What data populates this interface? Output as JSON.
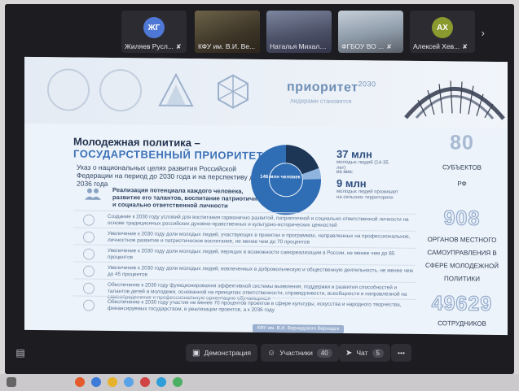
{
  "participants": [
    {
      "name": "Жиляев Русл...",
      "initials": "ЖГ",
      "color": "#4f78d6",
      "video": false,
      "mic_muted": true,
      "active": false
    },
    {
      "name": "КФУ им. В.И. Ве...",
      "initials": "",
      "color": "#5a4f3d",
      "video": true,
      "mic_muted": false,
      "active": true
    },
    {
      "name": "Наталья Михаль...",
      "initials": "",
      "color": "#6b6e7e",
      "video": true,
      "mic_muted": true,
      "active": false
    },
    {
      "name": "ФГБОУ ВО ...",
      "initials": "",
      "color": "#8d9aa8",
      "video": true,
      "mic_muted": true,
      "active": false
    },
    {
      "name": "Алексей Хев...",
      "initials": "АХ",
      "color": "#8a9a2f",
      "video": false,
      "mic_muted": true,
      "active": false
    }
  ],
  "next_icon": "chevron-right-icon",
  "slide": {
    "brand": "приоритет",
    "brand_year": "2030",
    "brand_sub": "лидерами становятся",
    "title_line1": "Молодежная политика –",
    "title_line2": "ГОСУДАРСТВЕННЫЙ ПРИОРИТЕТ",
    "decree": "Указ о национальных целях развития Российской Федерации на период до 2030 года и на перспективу до 2036 года",
    "potential": "Реализация потенциала каждого человека, развитие его талантов, воспитание патриотичной и социально ответственной личности",
    "donut_label": "146 млн человек",
    "stat1_big": "37 млн",
    "stat1_small": "молодых людей (14-35 лет)",
    "of_them": "из них:",
    "stat2_big": "9 млн",
    "stat2_small": "молодых людей проживает на сельских территориях",
    "bullets": [
      "Создание к 2030 году условий для воспитания гармонично развитой, патриотичной и социально ответственной личности на основе традиционных российских духовно-нравственных и культурно-исторических ценностей",
      "Увеличение к 2030 году доли молодых людей, участвующих в проектах и программах, направленных на профессиональное, личностное развитие и патриотическое воспитание, не менее чем до 70 процентов",
      "Увеличение к 2030 году доли молодых людей, верящих в возможности самореализации в России, не менее чем до 85 процентов",
      "Увеличение к 2030 году доли молодых людей, вовлеченных в добровольческую и общественную деятельность, не менее чем до 45 процентов",
      "Обеспечение к 2030 году функционирования эффективной системы выявления, поддержки и развития способностей и талантов детей и молодежи, основанной на принципах ответственности, справедливости, всеобщности и направленной на самоопределение и профессиональную ориентацию обучающихся",
      "Обеспечение к 2030 году участия не менее 70 процентов проектов в сфере культуры, искусства и народного творчества, финансируемых государством, в реализации проектов, а к 2036 году"
    ],
    "right_stats": [
      {
        "value": "80",
        "label": "СУБЪЕКТОВ РФ"
      },
      {
        "value": "908",
        "label": "ОРГАНОВ МЕСТНОГО САМОУПРАВЛЕНИЯ В СФЕРЕ МОЛОДЕЖНОЙ ПОЛИТИКИ"
      },
      {
        "value": "49629",
        "label": "СОТРУДНИКОВ"
      }
    ],
    "caption": "КФУ им. В.И. Вернадского Вернадск"
  },
  "toolbar": {
    "demo_label": "Демонстрация",
    "participants_label": "Участники",
    "participants_count": "40",
    "chat_label": "Чат",
    "chat_count": "5",
    "more_label": "•••"
  },
  "taskbar_colors": [
    "#e55a2c",
    "#3d7bd8",
    "#e7b22b",
    "#5aa3e8",
    "#d04444",
    "#2f9dd9",
    "#4bb063"
  ]
}
